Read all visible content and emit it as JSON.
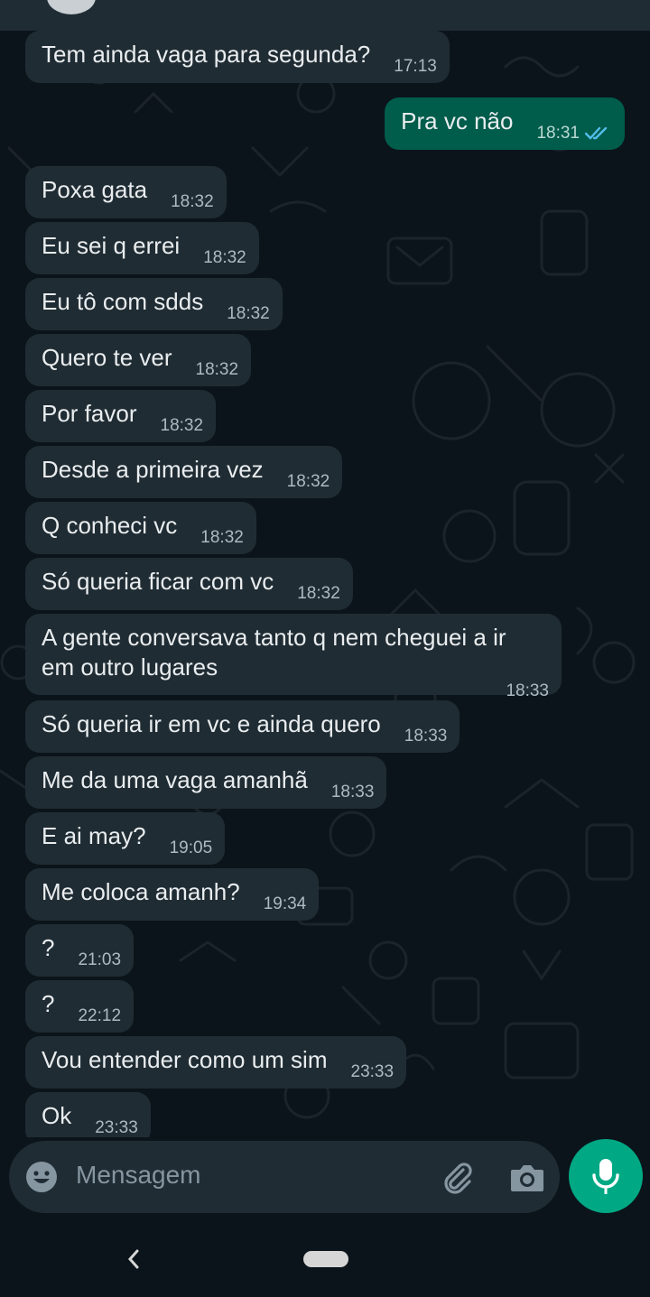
{
  "header": {
    "avatar": "contact-avatar"
  },
  "messages": [
    {
      "dir": "in",
      "text": "Tem ainda vaga para segunda?",
      "time": "17:13"
    },
    {
      "dir": "out",
      "text": "Pra vc não",
      "time": "18:31",
      "status": "read"
    },
    {
      "dir": "in",
      "text": "Poxa gata",
      "time": "18:32"
    },
    {
      "dir": "in",
      "text": "Eu sei q errei",
      "time": "18:32"
    },
    {
      "dir": "in",
      "text": "Eu tô com sdds",
      "time": "18:32"
    },
    {
      "dir": "in",
      "text": "Quero te ver",
      "time": "18:32"
    },
    {
      "dir": "in",
      "text": "Por favor",
      "time": "18:32"
    },
    {
      "dir": "in",
      "text": "Desde a primeira vez",
      "time": "18:32"
    },
    {
      "dir": "in",
      "text": "Q conheci vc",
      "time": "18:32"
    },
    {
      "dir": "in",
      "text": "Só queria ficar com vc",
      "time": "18:32"
    },
    {
      "dir": "in",
      "text": "A gente conversava tanto q nem cheguei a ir\nem outro lugares",
      "time": "18:33"
    },
    {
      "dir": "in",
      "text": "Só queria ir em vc e ainda quero",
      "time": "18:33"
    },
    {
      "dir": "in",
      "text": "Me da uma vaga amanhã",
      "time": "18:33"
    },
    {
      "dir": "in",
      "text": "E ai may?",
      "time": "19:05"
    },
    {
      "dir": "in",
      "text": "Me coloca amanh?",
      "time": "19:34"
    },
    {
      "dir": "in",
      "text": "?",
      "time": "21:03"
    },
    {
      "dir": "in",
      "text": "?",
      "time": "22:12"
    },
    {
      "dir": "in",
      "text": "Vou entender como um sim",
      "time": "23:33"
    },
    {
      "dir": "in",
      "text": "Ok",
      "time": "23:33"
    }
  ],
  "composer": {
    "placeholder": "Mensagem",
    "emoji_icon": "emoji-icon",
    "attach_icon": "paperclip-icon",
    "camera_icon": "camera-icon",
    "mic_icon": "microphone-icon"
  },
  "colors": {
    "background": "#0b141a",
    "incoming_bubble": "#202c33",
    "outgoing_bubble": "#005c4b",
    "accent": "#00a884",
    "read_tick": "#53bdeb"
  },
  "navbar": {
    "back_icon": "back-chevron-icon",
    "home_icon": "home-pill-icon"
  }
}
